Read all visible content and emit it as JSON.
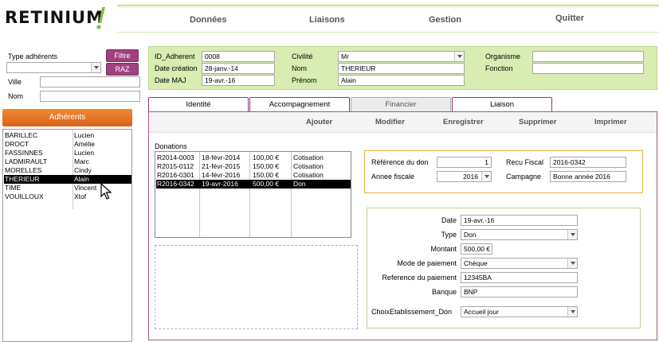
{
  "app": {
    "logo_text": "RETINIUM"
  },
  "nav": {
    "donnees": "Données",
    "liaisons": "Liaisons",
    "gestion": "Gestion",
    "quitter": "Quitter"
  },
  "filters": {
    "type_label": "Type adhérents",
    "filtre_label": "Filtre",
    "raz_label": "RAZ",
    "ville_label": "Ville",
    "nom_label": "Nom",
    "type_value": "",
    "ville_value": "",
    "nom_value": ""
  },
  "members": {
    "button_label": "Adhérents",
    "rows": [
      {
        "last": "BARILLEC",
        "first": "Lucien"
      },
      {
        "last": "DROCT",
        "first": "Amélie"
      },
      {
        "last": "FASSINNES",
        "first": "Lucien"
      },
      {
        "last": "LADMIRAULT",
        "first": "Marc"
      },
      {
        "last": "MORELLES",
        "first": "Cindy"
      },
      {
        "last": "THERIEUR",
        "first": "Alain"
      },
      {
        "last": "TIME",
        "first": "Vincent"
      },
      {
        "last": "VOUILLOUX",
        "first": "Xtof"
      }
    ]
  },
  "header": {
    "id_label": "ID_Adherent",
    "id_value": "0008",
    "date_creation_label": "Date création",
    "date_creation_value": "28-janv.-14",
    "date_maj_label": "Date MAJ",
    "date_maj_value": "19-avr.-16",
    "civilite_label": "Civilité",
    "civilite_value": "Mr",
    "nom_label": "Nom",
    "nom_value": "THERIEUR",
    "prenom_label": "Prénom",
    "prenom_value": "Alain",
    "organisme_label": "Organisme",
    "organisme_value": "",
    "fonction_label": "Fonction",
    "fonction_value": ""
  },
  "tabs": {
    "identite": "Identité",
    "accompagnement": "Accompagnement",
    "financier": "Financier",
    "liaison": "Liaison"
  },
  "toolbar": {
    "ajouter": "Ajouter",
    "modifier": "Modifier",
    "enregistrer": "Enregistrer",
    "supprimer": "Supprimer",
    "imprimer": "Imprimer"
  },
  "donations": {
    "label": "Donations",
    "rows": [
      {
        "ref": "R2014-0003",
        "date": "18-févr-2014",
        "amount": "100,00 €",
        "type": "Cotisation"
      },
      {
        "ref": "R2015-0112",
        "date": "21-févr-2015",
        "amount": "150,00 €",
        "type": "Cotisation"
      },
      {
        "ref": "R2016-0301",
        "date": "14-févr-2016",
        "amount": "150,00 €",
        "type": "Cotisation"
      },
      {
        "ref": "R2016-0342",
        "date": "19-avr-2016",
        "amount": "500,00 €",
        "type": "Don"
      }
    ]
  },
  "don": {
    "reference_label": "Référence du don",
    "reference_value": "1",
    "annee_label": "Annee fiscale",
    "annee_value": "2016",
    "recu_label": "Recu Fiscal",
    "recu_value": "2016-0342",
    "campagne_label": "Campagne",
    "campagne_value": "Bonne année 2016"
  },
  "detail": {
    "date_label": "Date",
    "date_value": "19-avr.-16",
    "type_label": "Type",
    "type_value": "Don",
    "montant_label": "Montant",
    "montant_value": "500,00 €",
    "mode_label": "Mode de paiement",
    "mode_value": "Chèque",
    "reference_label": "Reference du paiement",
    "reference_value": "12345BA",
    "banque_label": "Banque",
    "banque_value": "BNP",
    "etab_label": "ChoixEtablissement_Don",
    "etab_value": "Accueil jour"
  },
  "colors": {
    "accent_green": "#d9ecb1",
    "purple": "#a0427c",
    "orange": "#e8782a"
  }
}
